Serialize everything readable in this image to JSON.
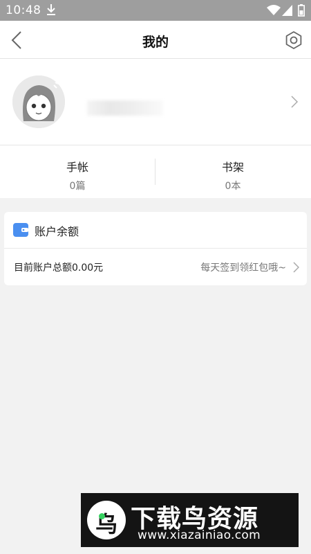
{
  "status_bar": {
    "time": "10:48",
    "icons": [
      "download-icon",
      "wifi-icon",
      "signal-icon",
      "battery-icon"
    ]
  },
  "header": {
    "title": "我的",
    "back_icon": "chevron-left-icon",
    "settings_icon": "gear-icon"
  },
  "profile": {
    "avatar": "cartoon-girl-avatar",
    "arrow_icon": "chevron-right-icon"
  },
  "stats": [
    {
      "label": "手帐",
      "count": "0篇"
    },
    {
      "label": "书架",
      "count": "0本"
    }
  ],
  "balance": {
    "title": "账户余额",
    "wallet_icon": "wallet-icon",
    "wallet_color": "#4a8ff0",
    "total": "目前账户总额0.00元",
    "promo": "每天签到领红包哦~"
  },
  "watermark": {
    "logo_char": "乌",
    "title": "下载鸟资源",
    "url": "www.xiazainiao.com",
    "accent": "#36d05f"
  }
}
